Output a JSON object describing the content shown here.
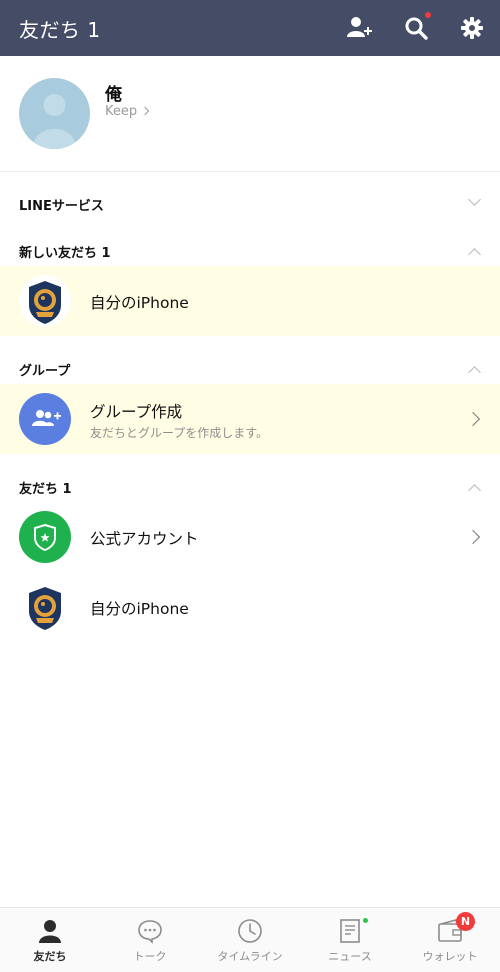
{
  "header": {
    "title": "友だち 1",
    "icons": [
      "add-friend-icon",
      "search-icon",
      "settings-icon"
    ]
  },
  "profile": {
    "name": "俺",
    "sub": "Keep"
  },
  "sections": {
    "line_services": "LINEサービス",
    "new_friends": "新しい友だち 1",
    "groups": "グループ",
    "friends": "友だち 1"
  },
  "new_friend_item": {
    "name": "自分のiPhone"
  },
  "group_item": {
    "title": "グループ作成",
    "subtitle": "友だちとグループを作成します。"
  },
  "friends_list": [
    {
      "name": "公式アカウント"
    },
    {
      "name": "自分のiPhone"
    }
  ],
  "tabbar": {
    "tabs": [
      {
        "label": "友だち",
        "active": true
      },
      {
        "label": "トーク"
      },
      {
        "label": "タイムライン"
      },
      {
        "label": "ニュース"
      },
      {
        "label": "ウォレット",
        "badge": "N"
      }
    ]
  },
  "colors": {
    "header_bg": "#454c65",
    "highlight_row": "#fffde3",
    "group_icon_bg": "#5b7fe0",
    "official_icon_bg": "#1fb14d",
    "badge_red": "#f23c3c"
  }
}
